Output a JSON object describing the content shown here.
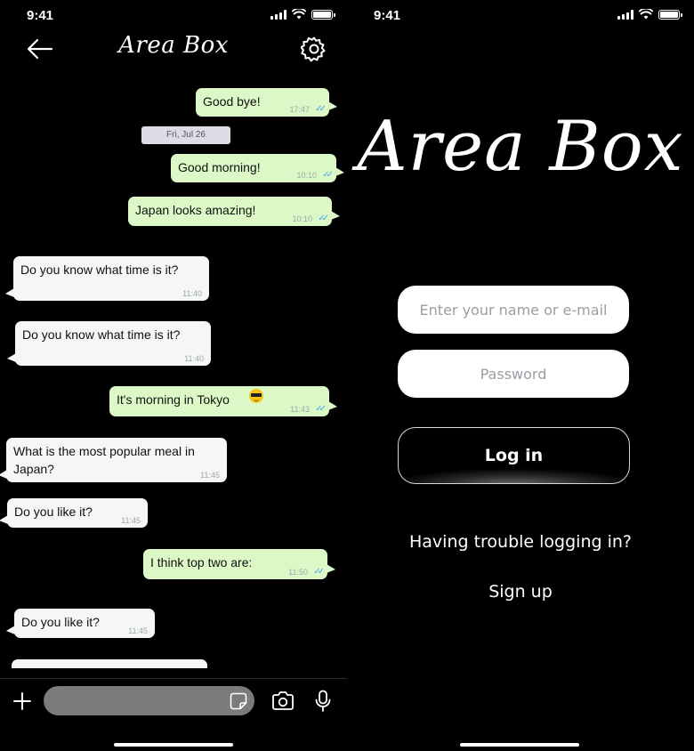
{
  "status_bar": {
    "time_left": "9:41",
    "time_right": "9:41"
  },
  "chat_screen": {
    "brand": "Area Box",
    "date_separator": "Fri, Jul 26",
    "messages": [
      {
        "text": "Good bye!",
        "time": "17:47",
        "direction": "out",
        "read": true
      },
      {
        "text": "Good morning!",
        "time": "10:10",
        "direction": "out",
        "read": true
      },
      {
        "text": "Japan looks amazing!",
        "time": "10:10",
        "direction": "out",
        "read": true
      },
      {
        "text": "Do you know what time is it?",
        "time": "11:40",
        "direction": "in"
      },
      {
        "text": "Do you know what time is it?",
        "time": "11:40",
        "direction": "in"
      },
      {
        "text": "It's morning in Tokyo",
        "time": "11:43",
        "direction": "out",
        "read": true,
        "emoji": "smiling-face-with-sunglasses"
      },
      {
        "text": "What is the most popular meal in Japan?",
        "time": "11:45",
        "direction": "in"
      },
      {
        "text": "Do you like it?",
        "time": "11:45",
        "direction": "in"
      },
      {
        "text": "I think top two are:",
        "time": "11:50",
        "direction": "out",
        "read": true
      },
      {
        "text": "Do you like it?",
        "time": "11:45",
        "direction": "in"
      }
    ],
    "composer": {
      "placeholder": ""
    },
    "colors": {
      "outgoing": "#dcf8c6",
      "incoming": "#f6f6f6",
      "read_ticks": "#4aa3f0",
      "composer_field": "#7b7b7b"
    }
  },
  "login_screen": {
    "brand": "Area Box",
    "username_placeholder": "Enter your name or e-mail",
    "password_placeholder": "Password",
    "login_label": "Log in",
    "trouble_label": "Having trouble logging in?",
    "signup_label": "Sign up"
  }
}
